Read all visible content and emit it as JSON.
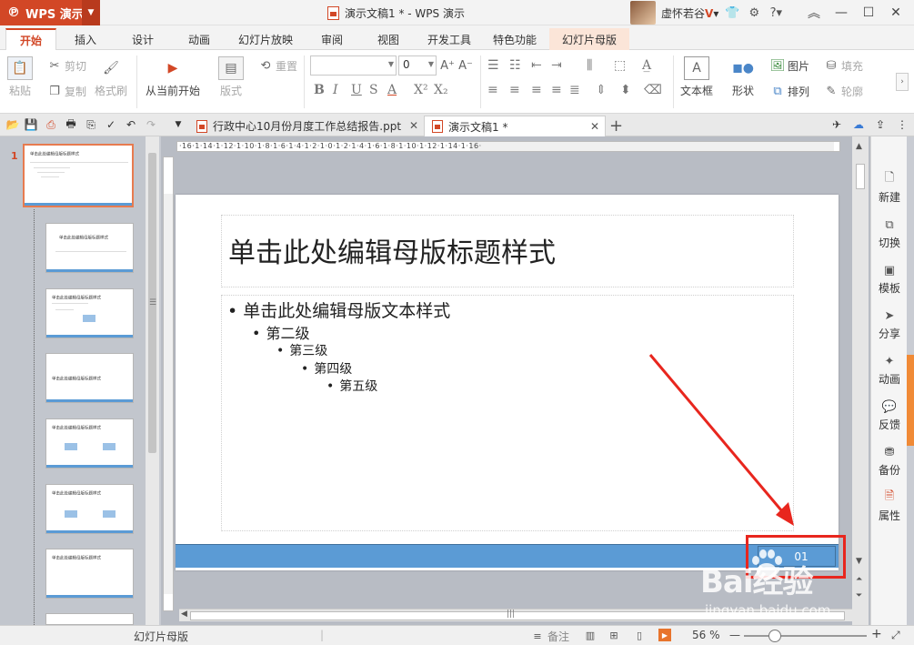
{
  "app": {
    "name": "WPS 演示",
    "window_title": "演示文稿1 * - WPS 演示",
    "user": "虚怀若谷",
    "user_badge": "V"
  },
  "menu_tabs": [
    {
      "label": "开始",
      "active": true
    },
    {
      "label": "插入"
    },
    {
      "label": "设计"
    },
    {
      "label": "动画"
    },
    {
      "label": "幻灯片放映"
    },
    {
      "label": "审阅"
    },
    {
      "label": "视图"
    },
    {
      "label": "开发工具"
    },
    {
      "label": "特色功能"
    },
    {
      "label": "幻灯片母版",
      "special": true
    }
  ],
  "ribbon": {
    "paste": "粘贴",
    "cut": "剪切",
    "copy": "复制",
    "format_painter": "格式刷",
    "from_current": "从当前开始",
    "layout": "版式",
    "reset": "重置",
    "font_size": "0",
    "textbox": "文本框",
    "shape": "形状",
    "picture": "图片",
    "arrange": "排列",
    "fill": "填充",
    "outline": "轮廓"
  },
  "doc_tabs": [
    {
      "label": "行政中心10月份月度工作总结报告.ppt"
    },
    {
      "label": "演示文稿1 *",
      "active": true
    }
  ],
  "thumbnails": {
    "master_number": "1",
    "master_title": "单击此处编辑母版标题样式",
    "layout_title": "单击此处编辑母版标题样式",
    "layout_small": "单击此处编辑母版标题样式"
  },
  "ruler": {
    "left": "16",
    "right": "16",
    "marks": "·16·1·14·1·12·1·10·1·8·1·6·1·4·1·2·1·0·1·2·1·4·1·6·1·8·1·10·1·12·1·14·1·16·"
  },
  "slide": {
    "title": "单击此处编辑母版标题样式",
    "levels": [
      "单击此处编辑母版文本样式",
      "第二级",
      "第三级",
      "第四级",
      "第五级"
    ],
    "page_number": "01"
  },
  "right_tools": [
    "新建",
    "切换",
    "模板",
    "分享",
    "动画",
    "反馈",
    "备份",
    "属性"
  ],
  "status": {
    "view": "幻灯片母版",
    "notes": "备注",
    "zoom": "56 %"
  },
  "watermark": {
    "main": "Bai经验",
    "sub": "jingyan.baidu.com"
  }
}
